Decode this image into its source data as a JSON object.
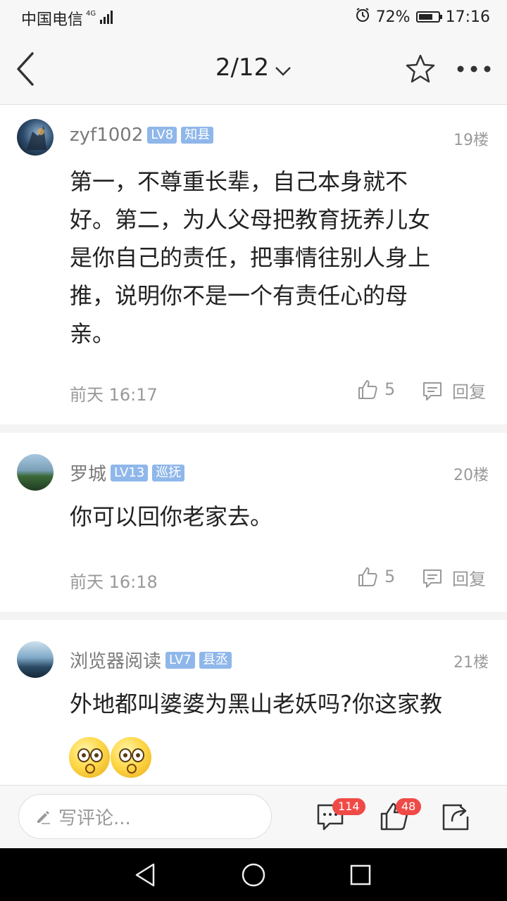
{
  "status_bar": {
    "carrier": "中国电信",
    "network": "4G",
    "battery": "72%",
    "battery_level": 0.72,
    "time": "17:16"
  },
  "nav": {
    "page_indicator": "2/12"
  },
  "comments": [
    {
      "username": "zyf1002",
      "level": "LV8",
      "title": "知县",
      "floor": "19楼",
      "content_lines": [
        "第一，不尊重长辈，自己本身就不",
        "好。第二，为人父母把教育抚养儿女",
        "是你自己的责任，把事情往别人身上",
        "推，说明你不是一个有责任心的母",
        "亲。"
      ],
      "time": "前天 16:17",
      "likes": "5",
      "reply_label": "回复"
    },
    {
      "username": "罗城",
      "level": "LV13",
      "title": "巡抚",
      "floor": "20楼",
      "content_lines": [
        "你可以回你老家去。"
      ],
      "time": "前天 16:18",
      "likes": "5",
      "reply_label": "回复"
    },
    {
      "username": "浏览器阅读",
      "level": "LV7",
      "title": "县丞",
      "floor": "21楼",
      "content_lines": [
        "外地都叫婆婆为黑山老妖吗?你这家教"
      ]
    }
  ],
  "bottom_bar": {
    "comment_placeholder": "写评论...",
    "comment_count": "114",
    "like_count": "48"
  },
  "icons": {
    "back": "back-arrow-icon",
    "dropdown": "chevron-down-icon",
    "favorite": "star-icon",
    "more": "more-icon",
    "like": "thumb-up-icon",
    "reply": "comment-bubble-icon",
    "share": "share-icon"
  },
  "colors": {
    "tag_bg": "#8fb7ea",
    "badge": "#f04a46",
    "text_main": "#222222",
    "text_muted": "#999999"
  }
}
